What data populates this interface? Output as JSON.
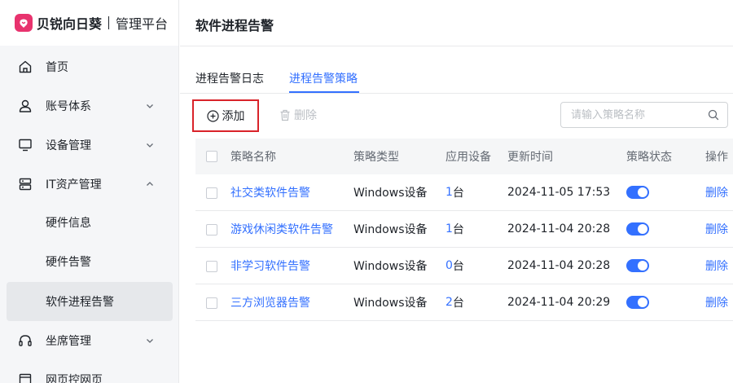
{
  "brand": {
    "name": "贝锐向日葵",
    "sub": "管理平台",
    "accent": "#e8336e"
  },
  "sidebar": {
    "items": [
      {
        "label": "首页",
        "icon": "home-icon"
      },
      {
        "label": "账号体系",
        "icon": "user-icon",
        "expanded": false
      },
      {
        "label": "设备管理",
        "icon": "monitor-icon",
        "expanded": false
      },
      {
        "label": "IT资产管理",
        "icon": "server-icon",
        "expanded": true
      },
      {
        "label": "硬件信息"
      },
      {
        "label": "硬件告警"
      },
      {
        "label": "软件进程告警",
        "active": true
      },
      {
        "label": "坐席管理",
        "icon": "headset-icon",
        "expanded": false
      },
      {
        "label": "网页控网页",
        "icon": "web-icon"
      }
    ]
  },
  "main": {
    "title": "软件进程告警",
    "tabs": [
      {
        "label": "进程告警日志",
        "active": false
      },
      {
        "label": "进程告警策略",
        "active": true
      }
    ],
    "toolbar": {
      "add_label": "添加",
      "delete_label": "删除",
      "search_placeholder": "请输入策略名称"
    },
    "table": {
      "headers": [
        "策略名称",
        "策略类型",
        "应用设备",
        "更新时间",
        "策略状态",
        "操作"
      ],
      "device_unit": "台",
      "rows": [
        {
          "name": "社交类软件告警",
          "type": "Windows设备",
          "devices": "1",
          "updated": "2024-11-05 17:53",
          "enabled": true,
          "action": "删除"
        },
        {
          "name": "游戏休闲类软件告警",
          "type": "Windows设备",
          "devices": "1",
          "updated": "2024-11-04 20:28",
          "enabled": true,
          "action": "删除"
        },
        {
          "name": "非学习软件告警",
          "type": "Windows设备",
          "devices": "0",
          "updated": "2024-11-04 20:28",
          "enabled": true,
          "action": "删除"
        },
        {
          "name": "三方浏览器告警",
          "type": "Windows设备",
          "devices": "2",
          "updated": "2024-11-04 20:29",
          "enabled": true,
          "action": "删除"
        }
      ]
    }
  },
  "colors": {
    "primary": "#3370ff",
    "highlight_border": "#d9232a"
  }
}
